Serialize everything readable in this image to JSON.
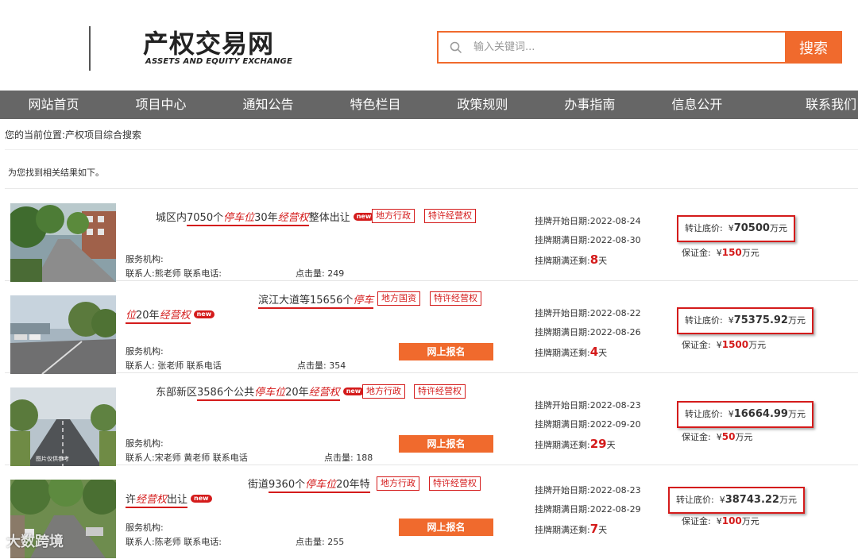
{
  "header": {
    "logo_title": "产权交易网",
    "logo_subtitle": "ASSETS AND EQUITY EXCHANGE",
    "search_placeholder": "输入关键词...",
    "search_button": "搜索"
  },
  "nav": [
    "网站首页",
    "项目中心",
    "通知公告",
    "特色栏目",
    "政策规则",
    "办事指南",
    "信息公开",
    "联系我们"
  ],
  "breadcrumb": "您的当前位置:产权项目综合搜索",
  "results_text": "为您找到相关结果如下。",
  "labels": {
    "org": "服务机构:",
    "clicks": "点击量:",
    "start_date": "挂牌开始日期:",
    "end_date": "挂牌期满日期:",
    "remaining": "挂牌期满还剩:",
    "days_unit": "天",
    "price_label": "转让底价:",
    "deposit_label": "保证金:",
    "signup": "网上报名",
    "new": "new",
    "currency": "¥",
    "wan_yuan": "万元"
  },
  "items": [
    {
      "title_parts": [
        "城区内",
        "7050个",
        "停车位",
        "30年",
        "经营权",
        "整体出让"
      ],
      "tags": [
        "地方行政",
        "特许经营权"
      ],
      "contact": "联系人:熊老师   联系电话:",
      "clicks": "249",
      "start": "2022-08-24",
      "end": "2022-08-30",
      "days_left": "8",
      "price": "70500",
      "deposit": "150",
      "has_signup": false
    },
    {
      "title_line1": [
        "滨江大道等",
        "15656个",
        "停车"
      ],
      "title_line2": [
        "位",
        "20年",
        "经营权"
      ],
      "tags": [
        "地方国资",
        "特许经营权"
      ],
      "contact": "联系人: 张老师   联系电话",
      "clicks": "354",
      "start": "2022-08-22",
      "end": "2022-08-26",
      "days_left": "4",
      "price": "75375.92",
      "deposit": "1500",
      "has_signup": true
    },
    {
      "title_parts": [
        "东部新区",
        "3586个公共",
        "停车位",
        "20年",
        "经营权"
      ],
      "tags": [
        "地方行政",
        "特许经营权"
      ],
      "contact": "联系人:宋老师 黄老师   联系电话",
      "clicks": "188",
      "start": "2022-08-23",
      "end": "2022-09-20",
      "days_left": "29",
      "price": "16664.99",
      "deposit": "50",
      "has_signup": true
    },
    {
      "title_line1": [
        "街道",
        "9360个",
        "停车位",
        "20年特"
      ],
      "title_line2": [
        "许",
        "经营权",
        "出让"
      ],
      "tags": [
        "地方行政",
        "特许经营权"
      ],
      "contact": "联系人:陈老师   联系电话:",
      "clicks": "255",
      "start": "2022-08-23",
      "end": "2022-08-29",
      "days_left": "7",
      "price": "38743.22",
      "deposit": "100",
      "has_signup": true
    }
  ],
  "watermark": "大数跨境",
  "colors": {
    "accent": "#f06a2d",
    "nav_bg": "#666666",
    "highlight": "#d41b1b"
  }
}
